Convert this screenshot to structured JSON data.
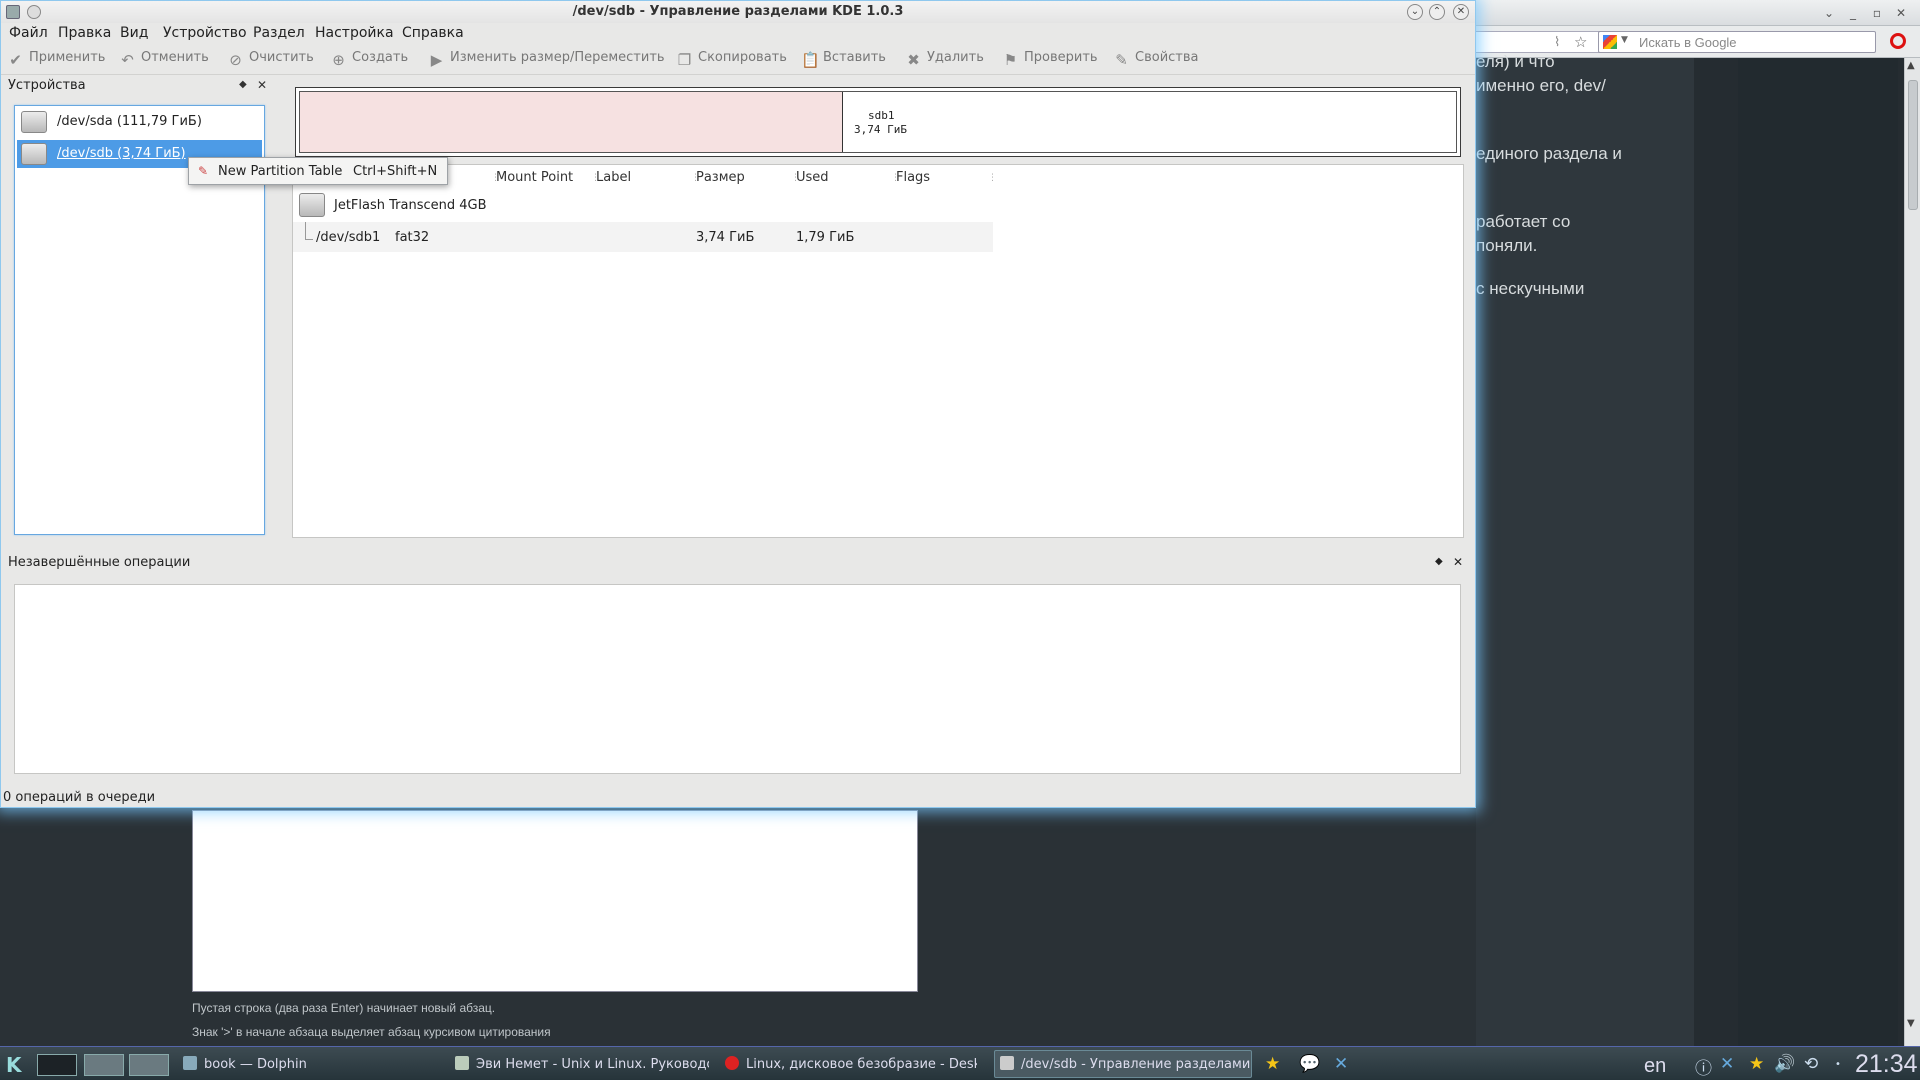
{
  "window": {
    "title": "/dev/sdb - Управление разделами KDE 1.0.3"
  },
  "menubar": {
    "items": [
      "Файл",
      "Правка",
      "Вид",
      "Устройство",
      "Раздел",
      "Настройка",
      "Справка"
    ]
  },
  "toolbar": {
    "apply": "Применить",
    "undo": "Отменить",
    "clear": "Очистить",
    "create": "Создать",
    "resize": "Изменить размер/Переместить",
    "copy": "Скопировать",
    "paste": "Вставить",
    "delete": "Удалить",
    "check": "Проверить",
    "properties": "Свойства"
  },
  "devices_panel": {
    "title": "Устройства",
    "items": [
      {
        "label": "/dev/sda (111,79 ГиБ)"
      },
      {
        "label": "/dev/sdb (3,74 ГиБ)",
        "selected": true
      }
    ]
  },
  "context_menu": {
    "label": "New Partition Table",
    "shortcut": "Ctrl+Shift+N"
  },
  "partition_graph": {
    "name": "sdb1",
    "size": "3,74 ГиБ"
  },
  "partition_table": {
    "columns": [
      "Mount Point",
      "Label",
      "Размер",
      "Used",
      "Flags"
    ],
    "device": "JetFlash Transcend 4GB",
    "rows": [
      {
        "partition": "/dev/sdb1",
        "fs": "fat32",
        "mount": "",
        "label": "",
        "size": "3,74 ГиБ",
        "used": "1,79 ГиБ",
        "flags": ""
      }
    ]
  },
  "pending_ops": {
    "title": "Незавершённые операции"
  },
  "status": "0 операций в очереди",
  "background_browser": {
    "search_placeholder": "Искать в Google",
    "lines": [
      "еля) и что",
      "именно его, dev/",
      "единого раздела и",
      "работает со",
      "поняли.",
      "с нескучными"
    ]
  },
  "background_editor": {
    "hint1": "Пустая строка (два раза Enter) начинает новый абзац.",
    "hint2": "Знак '>' в начале абзаца выделяет абзац курсивом цитирования"
  },
  "taskbar": {
    "tasks": [
      {
        "label": "book — Dolphin"
      },
      {
        "label": "Эви Немет - Unix и Linux. Руководство"
      },
      {
        "label": "Linux, дисковое безобразие - Desktop"
      },
      {
        "label": "/dev/sdb - Управление разделами KD"
      }
    ],
    "lang": "en",
    "clock": "21:34"
  }
}
